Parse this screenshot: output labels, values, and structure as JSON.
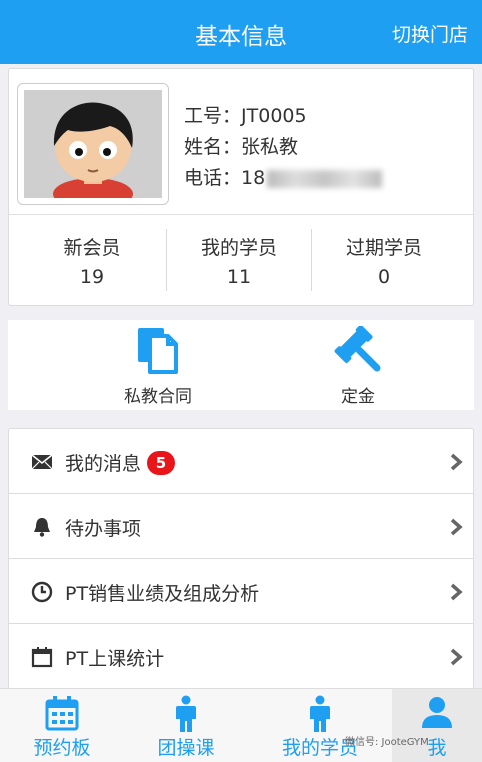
{
  "header": {
    "title": "基本信息",
    "switch_store": "切换门店"
  },
  "profile": {
    "id_label": "工号：",
    "id_value": "JT0005",
    "name_label": "姓名：",
    "name_value": "张私教",
    "phone_label": "电话：",
    "phone_value": "18"
  },
  "stats": [
    {
      "label": "新会员",
      "value": "19"
    },
    {
      "label": "我的学员",
      "value": "11"
    },
    {
      "label": "过期学员",
      "value": "0"
    }
  ],
  "actions": [
    {
      "label": "私教合同",
      "icon": "contract-icon"
    },
    {
      "label": "定金",
      "icon": "gavel-icon"
    }
  ],
  "menu": [
    {
      "label": "我的消息",
      "icon": "envelope-icon",
      "badge": "5"
    },
    {
      "label": "待办事项",
      "icon": "bell-icon"
    },
    {
      "label": "PT销售业绩及组成分析",
      "icon": "clock-icon"
    },
    {
      "label": "PT上课统计",
      "icon": "calendar-icon"
    }
  ],
  "tabs": [
    {
      "label": "预约板",
      "icon": "calendar-icon"
    },
    {
      "label": "团操课",
      "icon": "person-icon"
    },
    {
      "label": "我的学员",
      "icon": "person-icon"
    },
    {
      "label": "我",
      "icon": "user-icon"
    }
  ],
  "watermark": "微信号: JooteGYM",
  "colors": {
    "primary": "#1e9ff2",
    "badge": "#e8151b"
  }
}
